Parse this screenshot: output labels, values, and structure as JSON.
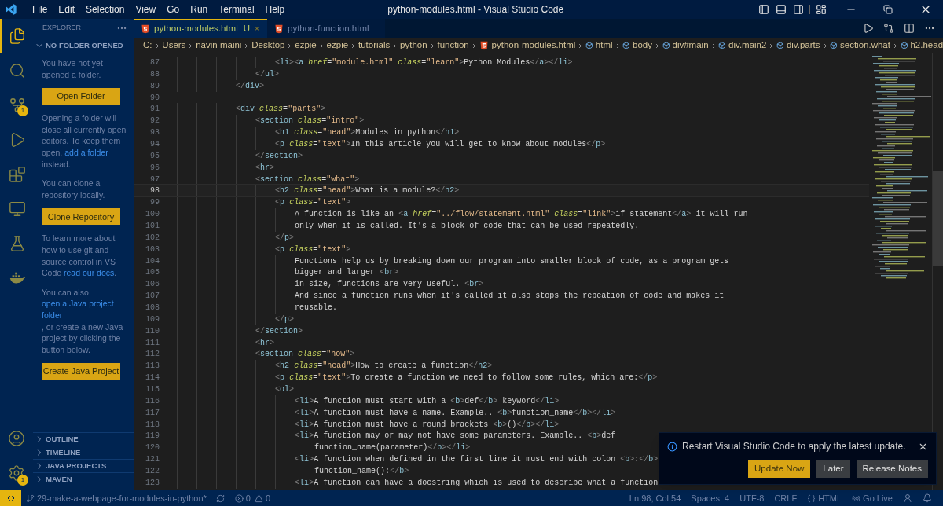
{
  "window": {
    "title": "python-modules.html - Visual Studio Code"
  },
  "menu": [
    "File",
    "Edit",
    "Selection",
    "View",
    "Go",
    "Run",
    "Terminal",
    "Help"
  ],
  "activity_bar": [
    {
      "kind": "files",
      "selected": true
    },
    {
      "kind": "search",
      "selected": false
    },
    {
      "kind": "source-control",
      "selected": false,
      "badge": "1"
    },
    {
      "kind": "run",
      "selected": false
    },
    {
      "kind": "extensions",
      "selected": false
    },
    {
      "kind": "remote",
      "selected": false
    },
    {
      "kind": "testing",
      "selected": false
    },
    {
      "kind": "docker",
      "selected": false
    }
  ],
  "activity_bottom": [
    {
      "kind": "account"
    },
    {
      "kind": "settings",
      "badge": "1"
    }
  ],
  "sidebar": {
    "title": "EXPLORER",
    "section": {
      "label": "NO FOLDER OPENED",
      "expanded": true
    },
    "content": [
      {
        "kind": "text",
        "segments": [
          {
            "kind": "text",
            "text": "You have not yet opened a folder."
          }
        ]
      },
      {
        "kind": "button",
        "label": "Open Folder"
      },
      {
        "kind": "text",
        "segments": [
          {
            "kind": "text",
            "text": "Opening a folder will close all currently open editors. To keep them open, "
          },
          {
            "kind": "link",
            "text": "add a folder"
          },
          {
            "kind": "text",
            "text": " instead."
          }
        ]
      },
      {
        "kind": "text",
        "segments": [
          {
            "kind": "text",
            "text": "You can clone a repository locally."
          }
        ]
      },
      {
        "kind": "button",
        "label": "Clone Repository"
      },
      {
        "kind": "text",
        "segments": [
          {
            "kind": "text",
            "text": "To learn more about how to use git and source control in VS Code "
          },
          {
            "kind": "link",
            "text": "read our docs"
          },
          {
            "kind": "text",
            "text": "."
          }
        ]
      },
      {
        "kind": "text",
        "segments": [
          {
            "kind": "text",
            "text": "You can also "
          },
          {
            "kind": "link",
            "text": "open a Java project folder"
          },
          {
            "kind": "text",
            "text": ", or create a new Java project by clicking the button below."
          }
        ]
      },
      {
        "kind": "button",
        "label": "Create Java Project"
      }
    ],
    "panels": [
      {
        "label": "OUTLINE",
        "expanded": false
      },
      {
        "label": "TIMELINE",
        "expanded": false
      },
      {
        "label": "JAVA PROJECTS",
        "expanded": false
      },
      {
        "label": "MAVEN",
        "expanded": false
      }
    ]
  },
  "tabs": [
    {
      "label": "python-modules.html",
      "status": "U",
      "selected": true
    },
    {
      "label": "python-function.html",
      "selected": false
    }
  ],
  "breadcrumbs": [
    {
      "kind": "folder",
      "text": "C:"
    },
    {
      "kind": "folder",
      "text": "Users"
    },
    {
      "kind": "folder",
      "text": "navin maini"
    },
    {
      "kind": "folder",
      "text": "Desktop"
    },
    {
      "kind": "folder",
      "text": "ezpie"
    },
    {
      "kind": "folder",
      "text": "ezpie"
    },
    {
      "kind": "folder",
      "text": "tutorials"
    },
    {
      "kind": "folder",
      "text": "python"
    },
    {
      "kind": "folder",
      "text": "function"
    },
    {
      "kind": "file",
      "text": "python-modules.html"
    },
    {
      "kind": "element",
      "text": "html"
    },
    {
      "kind": "element",
      "text": "body"
    },
    {
      "kind": "element",
      "text": "div#main"
    },
    {
      "kind": "element",
      "text": "div.main2"
    },
    {
      "kind": "element",
      "text": "div.parts"
    },
    {
      "kind": "element",
      "text": "section.what"
    },
    {
      "kind": "element",
      "text": "h2.head"
    }
  ],
  "code": [
    {
      "n": "87",
      "text": "                    <li><a href=\"module.html\" class=\"learn\">Python Modules</a></li>",
      "current": false
    },
    {
      "n": "88",
      "text": "                </ul>",
      "current": false
    },
    {
      "n": "89",
      "text": "            </div>",
      "current": false
    },
    {
      "n": "90",
      "current": false
    },
    {
      "n": "91",
      "text": "            <div class=\"parts\">",
      "current": false
    },
    {
      "n": "92",
      "text": "                <section class=\"intro\">",
      "current": false
    },
    {
      "n": "93",
      "text": "                    <h1 class=\"head\">Modules in python</h1>",
      "current": false
    },
    {
      "n": "94",
      "text": "                    <p class=\"text\">In this article you will get to know about modules</p>",
      "current": false
    },
    {
      "n": "95",
      "text": "                </section>",
      "current": false
    },
    {
      "n": "96",
      "text": "                <hr>",
      "current": false
    },
    {
      "n": "97",
      "text": "                <section class=\"what\">",
      "current": false
    },
    {
      "n": "98",
      "text": "                    <h2 class=\"head\">What is a module?</h2>",
      "current": true
    },
    {
      "n": "99",
      "text": "                    <p class=\"text\">",
      "current": false
    },
    {
      "n": "100",
      "text": "                        A function is like an <a href=\"../flow/statement.html\" class=\"link\">if statement</a> it will run",
      "current": false
    },
    {
      "n": "101",
      "text": "                        only when it is called. It's a block of code that can be used repeatedly.",
      "current": false
    },
    {
      "n": "102",
      "text": "                    </p>",
      "current": false
    },
    {
      "n": "103",
      "text": "                    <p class=\"text\">",
      "current": false
    },
    {
      "n": "104",
      "text": "                        Functions help us by breaking down our program into smaller block of code, as a program gets",
      "current": false
    },
    {
      "n": "105",
      "text": "                        bigger and larger <br>",
      "current": false
    },
    {
      "n": "106",
      "text": "                        in size, functions are very useful. <br>",
      "current": false
    },
    {
      "n": "107",
      "text": "                        And since a function runs when it's called it also stops the repeation of code and makes it",
      "current": false
    },
    {
      "n": "108",
      "text": "                        reusable.",
      "current": false
    },
    {
      "n": "109",
      "text": "                    </p>",
      "current": false
    },
    {
      "n": "110",
      "text": "                </section>",
      "current": false
    },
    {
      "n": "111",
      "text": "                <hr>",
      "current": false
    },
    {
      "n": "112",
      "text": "                <section class=\"how\">",
      "current": false
    },
    {
      "n": "113",
      "text": "                    <h2 class=\"head\">How to create a function</h2>",
      "current": false
    },
    {
      "n": "114",
      "text": "                    <p class=\"text\">To create a function we need to follow some rules, which are:</p>",
      "current": false
    },
    {
      "n": "115",
      "text": "                    <ol>",
      "current": false
    },
    {
      "n": "116",
      "text": "                        <li>A function must start with a <b>def</b> keyword</li>",
      "current": false
    },
    {
      "n": "117",
      "text": "                        <li>A function must have a name. Example.. <b>function_name</b></li>",
      "current": false
    },
    {
      "n": "118",
      "text": "                        <li>A function must have a round brackets <b>()</b></li>",
      "current": false
    },
    {
      "n": "119",
      "text": "                        <li>A function may or may not have some parameters. Example.. <b>def",
      "current": false
    },
    {
      "n": "120",
      "text": "                            function_name(parameter)</b></li>",
      "current": false
    },
    {
      "n": "121",
      "text": "                        <li>A function when defined in the first line it must end with colon <b>:</b>",
      "current": false
    },
    {
      "n": "122",
      "text": "                            function_name():</b>",
      "current": false
    },
    {
      "n": "123",
      "text": "                        <li>A function can have a docstring which is used to describe what a function",
      "current": false
    }
  ],
  "notification": {
    "message": "Restart Visual Studio Code to apply the latest update.",
    "buttons": [
      {
        "label": "Update Now",
        "primary": true
      },
      {
        "label": "Later",
        "primary": false
      },
      {
        "label": "Release Notes",
        "primary": false
      }
    ]
  },
  "status_bar": {
    "branch": "29-make-a-webpage-for-modules-in-python*",
    "errors": "0",
    "warnings": "0",
    "position": "Ln 98, Col 54",
    "indent": "Spaces: 4",
    "encoding": "UTF-8",
    "eol": "CRLF",
    "language": "HTML",
    "live": "Go Live"
  }
}
